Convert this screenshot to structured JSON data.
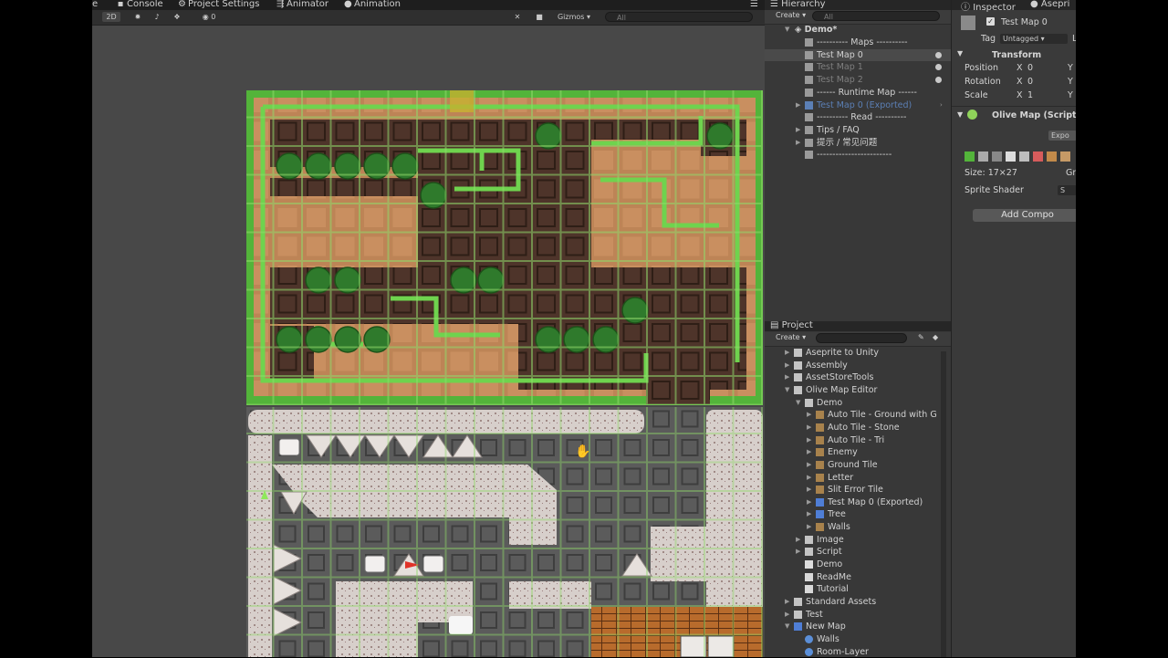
{
  "tabs": {
    "console": "Console",
    "project_settings": "Project Settings",
    "animator": "Animator",
    "animation": "Animation",
    "partial_left": "e"
  },
  "scene_toolbar": {
    "mode_2d": "2D",
    "gizmos": "Gizmos",
    "search_placeholder": "All",
    "hidden_count": "0"
  },
  "hierarchy": {
    "title": "Hierarchy",
    "create": "Create",
    "search_placeholder": "All",
    "scene": "Demo*",
    "items": [
      {
        "label": "---------- Maps ----------",
        "state": "normal"
      },
      {
        "label": "Test Map 0",
        "state": "selected"
      },
      {
        "label": "Test Map 1",
        "state": "faded"
      },
      {
        "label": "Test Map 2",
        "state": "faded"
      },
      {
        "label": "------ Runtime Map ------",
        "state": "normal"
      },
      {
        "label": "Test Map 0 (Exported)",
        "state": "prefab"
      },
      {
        "label": "---------- Read ----------",
        "state": "normal"
      },
      {
        "label": "Tips / FAQ",
        "state": "normal"
      },
      {
        "label": "提示 / 常见问题",
        "state": "normal"
      },
      {
        "label": "------------------------",
        "state": "normal"
      }
    ]
  },
  "project": {
    "title": "Project",
    "create": "Create",
    "items": [
      {
        "label": "Aseprite to Unity",
        "type": "folder"
      },
      {
        "label": "Assembly",
        "type": "folder"
      },
      {
        "label": "AssetStoreTools",
        "type": "folder"
      },
      {
        "label": "Olive Map Editor",
        "type": "folder"
      },
      {
        "label": "Demo",
        "type": "folder"
      },
      {
        "label": "Auto Tile - Ground with G",
        "type": "tile"
      },
      {
        "label": "Auto Tile - Stone",
        "type": "tile"
      },
      {
        "label": "Auto Tile - Tri",
        "type": "tile"
      },
      {
        "label": "Enemy",
        "type": "tile"
      },
      {
        "label": "Ground Tile",
        "type": "tile"
      },
      {
        "label": "Letter",
        "type": "tile"
      },
      {
        "label": "Slit Error Tile",
        "type": "tile"
      },
      {
        "label": "Test Map 0 (Exported)",
        "type": "prefab"
      },
      {
        "label": "Tree",
        "type": "prefab"
      },
      {
        "label": "Walls",
        "type": "tile"
      },
      {
        "label": "Image",
        "type": "folder"
      },
      {
        "label": "Script",
        "type": "folder"
      },
      {
        "label": "Demo",
        "type": "scene"
      },
      {
        "label": "ReadMe",
        "type": "doc"
      },
      {
        "label": "Tutorial",
        "type": "doc"
      },
      {
        "label": "Standard Assets",
        "type": "folder"
      },
      {
        "label": "Test",
        "type": "folder"
      },
      {
        "label": "New Map",
        "type": "prefab"
      },
      {
        "label": "Walls",
        "type": "sphere"
      },
      {
        "label": "Room-Layer",
        "type": "sphere"
      }
    ]
  },
  "inspector": {
    "tab": "Inspector",
    "tab2": "Asepri",
    "object_name": "Test Map 0",
    "tag_label": "Tag",
    "tag_value": "Untagged",
    "layer_partial": "L",
    "transform_title": "Transform",
    "position_label": "Position",
    "rotation_label": "Rotation",
    "scale_label": "Scale",
    "x_label": "X",
    "y_label": "Y",
    "position_x": "0",
    "rotation_x": "0",
    "scale_x": "1",
    "component_title": "Olive Map (Script",
    "export_button": "Expo",
    "size_label": "Size: 17×27",
    "size_partial": "Gr",
    "sprite_shader_label": "Sprite Shader",
    "sprite_shader_value": "S",
    "add_component": "Add Compo"
  },
  "colors": {
    "scene_bg": "#484848",
    "panel_bg": "#383838",
    "selection": "#4a4a4a",
    "grass_green": "#53b43a",
    "dirt": "#b07a4d",
    "dark_soil": "#4e342a",
    "stone": "#d4ccc8",
    "prefab_blue": "#5b7fb5"
  }
}
